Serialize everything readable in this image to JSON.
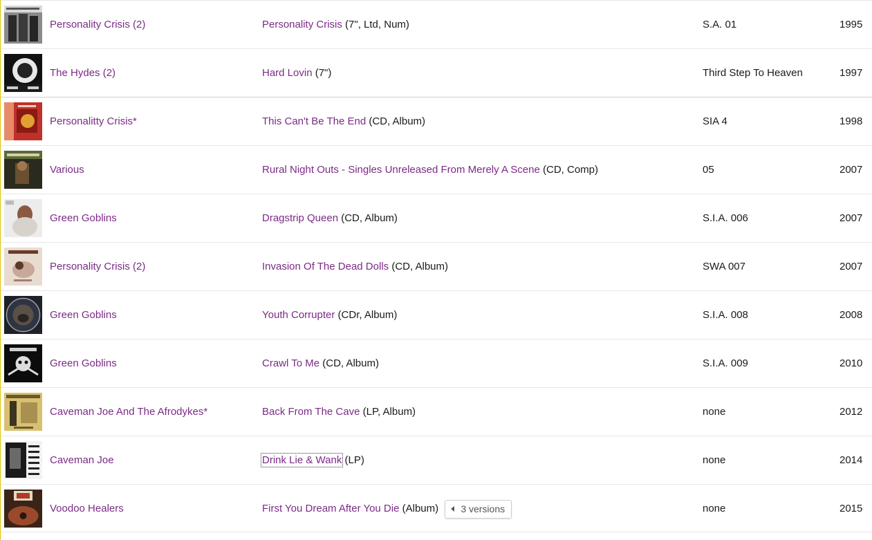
{
  "colors": {
    "link": "#7b2a86",
    "text": "#1a1a1a",
    "border": "#e6e6e6",
    "accent_edge": "#e3c200"
  },
  "releases": [
    {
      "artist": "Personality Crisis (2)",
      "title": "Personality Crisis",
      "format": "(7\", Ltd, Num)",
      "label_cat": "S.A. 01",
      "year": "1995"
    },
    {
      "artist": "The Hydes (2)",
      "title": "Hard Lovin",
      "format": "(7\")",
      "label_cat": "Third Step To Heaven",
      "year": "1997"
    },
    {
      "artist": "Personalitty Crisis*",
      "title": "This Can't Be The End",
      "format": "(CD, Album)",
      "label_cat": "SIA 4",
      "year": "1998"
    },
    {
      "artist": "Various",
      "title": "Rural Night Outs - Singles Unreleased From Merely A Scene",
      "format": "(CD, Comp)",
      "label_cat": "05",
      "year": "2007"
    },
    {
      "artist": "Green Goblins",
      "title": "Dragstrip Queen",
      "format": "(CD, Album)",
      "label_cat": "S.I.A. 006",
      "year": "2007"
    },
    {
      "artist": "Personality Crisis (2)",
      "title": "Invasion Of The Dead Dolls",
      "format": "(CD, Album)",
      "label_cat": "SWA 007",
      "year": "2007"
    },
    {
      "artist": "Green Goblins",
      "title": "Youth Corrupter",
      "format": "(CDr, Album)",
      "label_cat": "S.I.A. 008",
      "year": "2008"
    },
    {
      "artist": "Green Goblins",
      "title": "Crawl To Me",
      "format": "(CD, Album)",
      "label_cat": "S.I.A. 009",
      "year": "2010"
    },
    {
      "artist": "Caveman Joe And The Afrodykes*",
      "title": "Back From The Cave",
      "format": "(LP, Album)",
      "label_cat": "none",
      "year": "2012"
    },
    {
      "artist": "Caveman Joe",
      "title": "Drink Lie & Wank",
      "format": "(LP)",
      "label_cat": "none",
      "year": "2014"
    },
    {
      "artist": "Voodoo Healers",
      "title": "First You Dream After You Die",
      "format": "(Album)",
      "label_cat": "none",
      "year": "2015",
      "versions_label": "3 versions"
    }
  ]
}
